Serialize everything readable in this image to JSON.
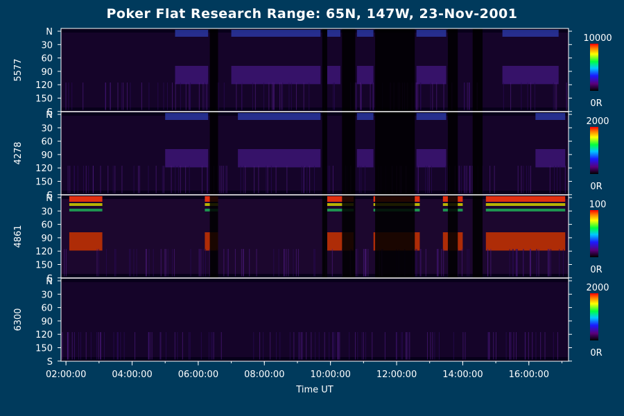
{
  "chart_data": {
    "type": "heatmap",
    "title": "Poker Flat Research Range: 65N, 147W, 23-Nov-2001",
    "xlabel": "Time UT",
    "x_ticks": [
      "02:00:00",
      "04:00:00",
      "06:00:00",
      "08:00:00",
      "10:00:00",
      "12:00:00",
      "14:00:00",
      "16:00:00"
    ],
    "x_range_hours": [
      1.85,
      17.2
    ],
    "y_tick_labels": [
      "N",
      "30",
      "60",
      "90",
      "120",
      "150",
      "S"
    ],
    "panels": [
      {
        "name": "5577",
        "scale_max": "10000",
        "scale_min": "0R",
        "bright_intervals": [
          [
            5.3,
            6.3
          ],
          [
            7.0,
            9.7
          ],
          [
            9.9,
            10.3
          ],
          [
            10.8,
            11.3
          ],
          [
            12.6,
            13.5
          ],
          [
            15.2,
            16.9
          ]
        ]
      },
      {
        "name": "4278",
        "scale_max": "2000",
        "scale_min": "0R",
        "bright_intervals": [
          [
            5.0,
            6.3
          ],
          [
            7.2,
            9.7
          ],
          [
            10.8,
            11.3
          ],
          [
            12.6,
            13.5
          ],
          [
            16.2,
            17.1
          ]
        ]
      },
      {
        "name": "4861",
        "scale_max": "100",
        "scale_min": "0R",
        "bright_intervals": [
          [
            2.1,
            3.1
          ],
          [
            6.2,
            6.6
          ],
          [
            9.9,
            10.7
          ],
          [
            11.3,
            12.7
          ],
          [
            13.4,
            14.0
          ],
          [
            14.7,
            17.1
          ]
        ]
      },
      {
        "name": "6300",
        "scale_max": "2000",
        "scale_min": "0R",
        "bright_intervals": []
      }
    ]
  }
}
